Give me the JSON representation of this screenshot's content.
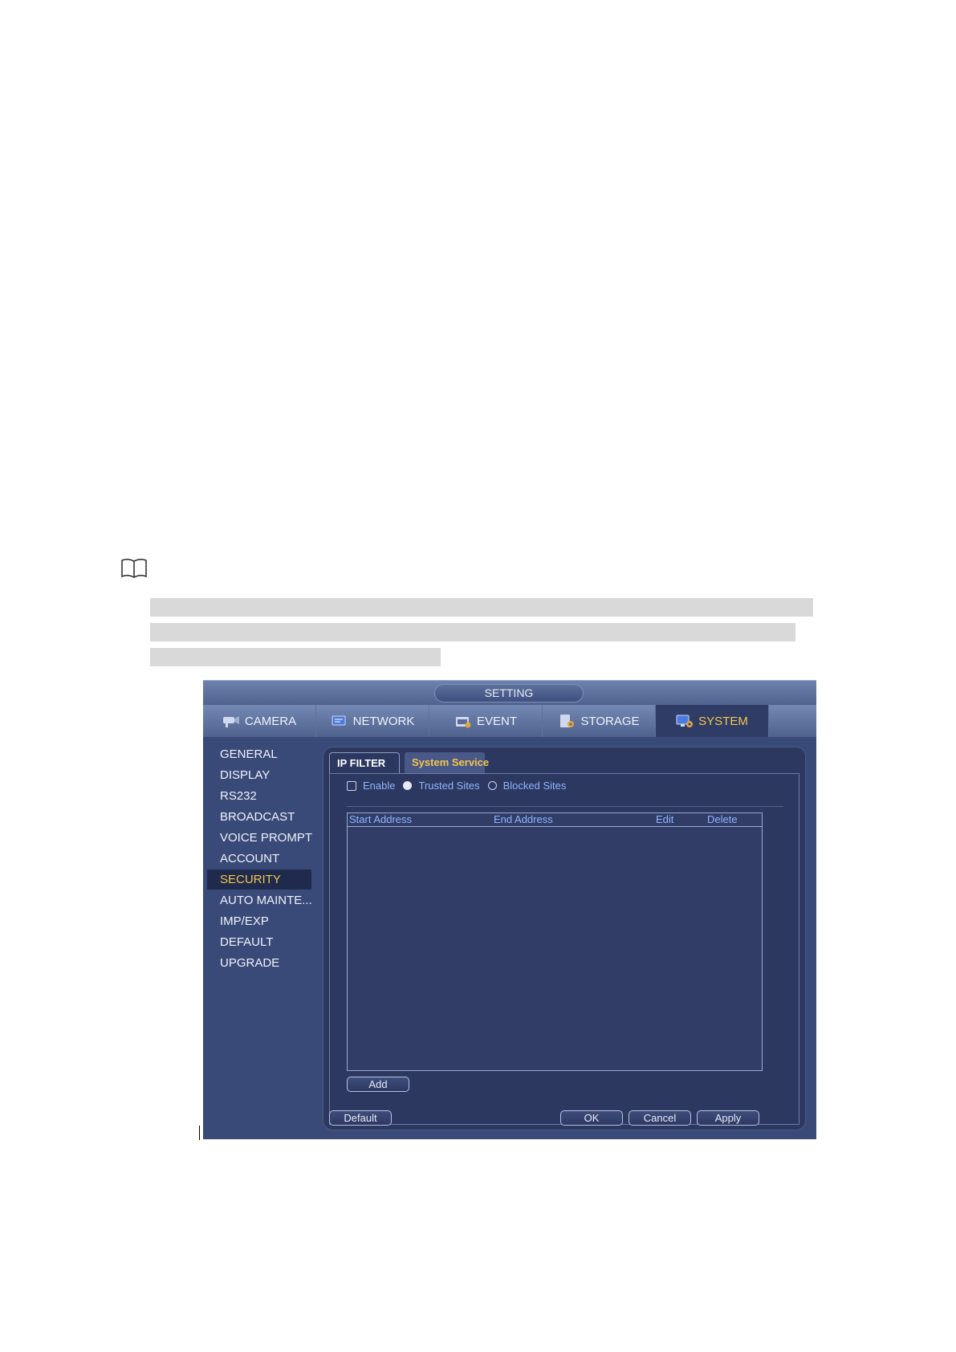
{
  "window": {
    "title": "SETTING"
  },
  "top_tabs": [
    {
      "label": "CAMERA",
      "icon": "camera-icon"
    },
    {
      "label": "NETWORK",
      "icon": "network-icon"
    },
    {
      "label": "EVENT",
      "icon": "event-icon"
    },
    {
      "label": "STORAGE",
      "icon": "storage-icon"
    },
    {
      "label": "SYSTEM",
      "icon": "system-icon",
      "active": true
    }
  ],
  "sidebar": {
    "items": [
      {
        "label": "GENERAL"
      },
      {
        "label": "DISPLAY"
      },
      {
        "label": "RS232"
      },
      {
        "label": "BROADCAST"
      },
      {
        "label": "VOICE PROMPT"
      },
      {
        "label": "ACCOUNT"
      },
      {
        "label": "SECURITY",
        "active": true
      },
      {
        "label": "AUTO MAINTE..."
      },
      {
        "label": "IMP/EXP"
      },
      {
        "label": "DEFAULT"
      },
      {
        "label": "UPGRADE"
      }
    ]
  },
  "sub_tabs": [
    {
      "label": "IP FILTER",
      "active": true
    },
    {
      "label": "System Service"
    }
  ],
  "ip_filter": {
    "enable_label": "Enable",
    "enable_checked": false,
    "trusted_label": "Trusted Sites",
    "blocked_label": "Blocked Sites",
    "selected_mode": "Trusted Sites",
    "table": {
      "columns": [
        "Start Address",
        "End Address",
        "Edit",
        "Delete"
      ],
      "rows": []
    },
    "add_label": "Add"
  },
  "footer": {
    "default_label": "Default",
    "ok_label": "OK",
    "cancel_label": "Cancel",
    "apply_label": "Apply"
  },
  "colors": {
    "accent_active": "#f5c64a",
    "background": "#3a4a78",
    "text_link": "#8fb4ff"
  }
}
